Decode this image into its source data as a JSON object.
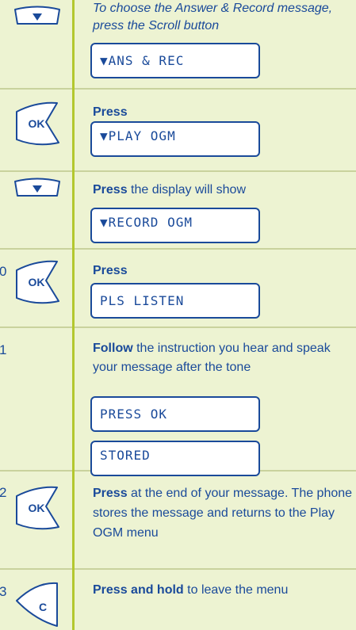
{
  "steps": [
    {
      "num": "",
      "key": "scroll-down",
      "text_lead": "",
      "text_rest": "To choose the Answer & Record message, press the Scroll button",
      "displays": [
        "▼ANS & REC"
      ]
    },
    {
      "num": "",
      "key": "ok",
      "text_lead": "Press",
      "text_rest": "",
      "displays": [
        "▼PLAY OGM"
      ]
    },
    {
      "num": "",
      "key": "scroll-down",
      "text_lead": "Press",
      "text_rest": " the display will show",
      "displays": [
        "▼RECORD OGM"
      ]
    },
    {
      "num": "0",
      "key": "ok",
      "text_lead": "Press",
      "text_rest": "",
      "displays": [
        "PLS LISTEN"
      ]
    },
    {
      "num": "1",
      "key": "",
      "text_lead": "Follow",
      "text_rest": " the instruction you hear and speak your message after the tone",
      "displays": [
        "PRESS OK",
        "STORED"
      ]
    },
    {
      "num": "2",
      "key": "ok",
      "text_lead": "Press",
      "text_rest": " at the end of your message. The phone stores the message and returns to the Play OGM menu",
      "displays": []
    },
    {
      "num": "3",
      "key": "clear",
      "text_lead": "Press and hold",
      "text_rest": " to leave the menu",
      "displays": []
    }
  ],
  "key_labels": {
    "ok": "OK",
    "clear": "C"
  },
  "colors": {
    "text": "#1a4a9a",
    "background": "#edf3d2",
    "accent_line": "#b3c72e",
    "divider": "#c9d29d"
  }
}
